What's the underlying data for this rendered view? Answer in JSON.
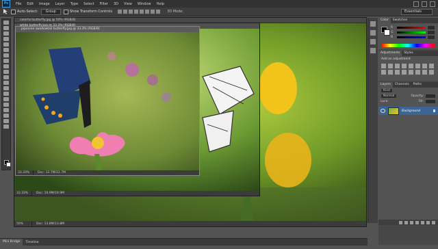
{
  "app": {
    "logo": "Ps"
  },
  "menu": [
    "File",
    "Edit",
    "Image",
    "Layer",
    "Type",
    "Select",
    "Filter",
    "3D",
    "View",
    "Window",
    "Help"
  ],
  "options_bar": {
    "auto_select_label": "Auto-Select:",
    "auto_select_value": "Group",
    "transform_label": "Show Transform Controls",
    "mode_3d_label": "3D Mode:",
    "workspace": "Essentials"
  },
  "documents": {
    "back": {
      "title": "colorful butterfly.jpg @ 50% (RGB/8)",
      "zoom": "50%",
      "doc_info": "Doc: 13.8M/13.8M"
    },
    "middle": {
      "title": "white butterfly.jpg @ 33.3% (RGB/8)",
      "zoom": "33.33%",
      "doc_info": "Doc: 19.9M/19.9M"
    },
    "front": {
      "title": "pipevine swallowtail butterfly.jpg @ 33.3% (RGB/8)",
      "zoom": "33.33%",
      "doc_info": "Doc: 12.7M/12.7M"
    }
  },
  "panels": {
    "color": {
      "tabs": [
        "Color",
        "Swatches"
      ],
      "sliders": [
        "R",
        "G",
        "B"
      ]
    },
    "adjustments": {
      "tabs": [
        "Adjustments",
        "Styles"
      ],
      "heading": "Add an adjustment"
    },
    "layers": {
      "tabs": [
        "Layers",
        "Channels",
        "Paths"
      ],
      "kind_label": "Kind",
      "blend_mode": "Normal",
      "opacity_label": "Opacity:",
      "lock_label": "Lock:",
      "fill_label": "Fill:",
      "background_layer": "Background"
    }
  },
  "bottom_tabs": [
    "Mini Bridge",
    "Timeline"
  ],
  "colors": {
    "accent": "#3c6595",
    "menubar": "#323232",
    "workspace": "#535353"
  }
}
